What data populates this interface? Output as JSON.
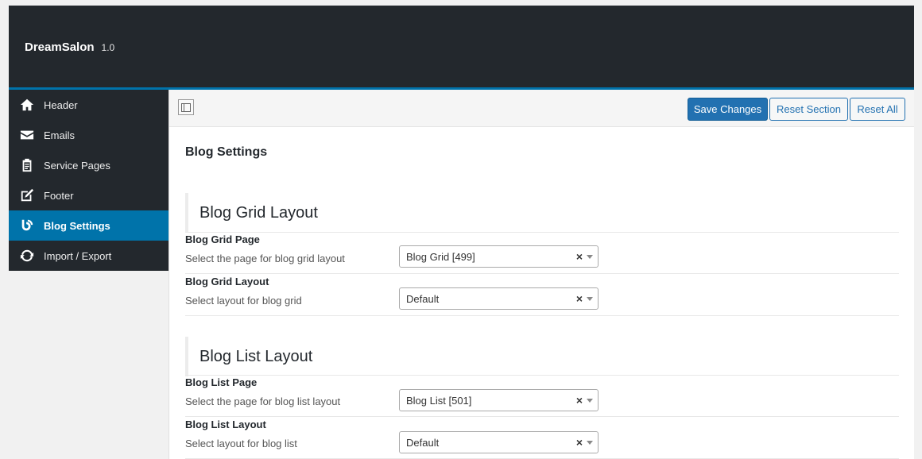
{
  "app": {
    "name": "DreamSalon",
    "version": "1.0"
  },
  "sidebar": {
    "items": [
      {
        "label": "Header",
        "icon": "home-icon"
      },
      {
        "label": "Emails",
        "icon": "envelope-icon"
      },
      {
        "label": "Service Pages",
        "icon": "clipboard-icon"
      },
      {
        "label": "Footer",
        "icon": "edit-icon"
      },
      {
        "label": "Blog Settings",
        "icon": "blog-feed-icon",
        "active": true
      },
      {
        "label": "Import / Export",
        "icon": "refresh-icon"
      }
    ]
  },
  "toolbar": {
    "save_label": "Save Changes",
    "reset_section_label": "Reset Section",
    "reset_all_label": "Reset All"
  },
  "page": {
    "title": "Blog Settings"
  },
  "sections": [
    {
      "title": "Blog Grid Layout",
      "fields": [
        {
          "label": "Blog Grid Page",
          "desc": "Select the page for blog grid layout",
          "value": "Blog Grid [499]"
        },
        {
          "label": "Blog Grid Layout",
          "desc": "Select layout for blog grid",
          "value": "Default"
        }
      ]
    },
    {
      "title": "Blog List Layout",
      "fields": [
        {
          "label": "Blog List Page",
          "desc": "Select the page for blog list layout",
          "value": "Blog List [501]"
        },
        {
          "label": "Blog List Layout",
          "desc": "Select layout for blog list",
          "value": "Default"
        }
      ]
    }
  ],
  "colors": {
    "topbar": "#23282d",
    "accent": "#0073aa",
    "primary_button": "#2271b1"
  }
}
